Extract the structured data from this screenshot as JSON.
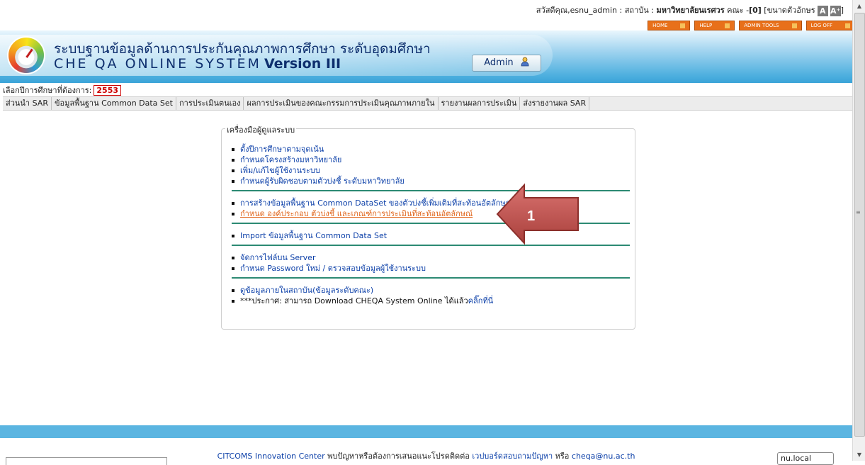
{
  "topbar": {
    "greeting": "สวัสดีคุณ,esnu_admin : สถาบัน  : ",
    "institution": "มหาวิทยาลัยนเรศวร",
    "faculty": "คณะ  -",
    "count": "[0]",
    "font_size_label": "[ขนาดตัวอักษร",
    "font_small": "A",
    "font_large": "A⁺",
    "close_bracket": "]"
  },
  "navbuttons": {
    "home": "HOME",
    "help": "HELP",
    "admin_tools": "ADMIN TOOLS",
    "logoff": "LOG OFF"
  },
  "header": {
    "title_th": "ระบบฐานข้อมูลด้านการประกันคุณภาพการศึกษา ระดับอุดมศึกษา",
    "title_en": "CHE QA ONLINE SYSTEM",
    "version": "Version III",
    "role": "Admin"
  },
  "year": {
    "label": "เลือกปีการศึกษาที่ต้องการ:",
    "value": "2553"
  },
  "menu": [
    "ส่วนนำ SAR",
    "ข้อมูลพื้นฐาน Common Data Set",
    "การประเมินตนเอง",
    "ผลการประเมินของคณะกรรมการประเมินคุณภาพภายใน",
    "รายงานผลการประเมิน",
    "ส่งรายงานผล SAR"
  ],
  "toolbox": {
    "title": "เครื่องมือผู้ดูแลระบบ",
    "group1": [
      "ตั้งปีการศึกษาตามจุดเน้น",
      "กำหนดโครงสร้างมหาวิทยาลัย",
      "เพิ่ม/แก้ไขผู้ใช้งานระบบ",
      "กำหนดผู้รับผิดชอบตามตัวบ่งชี้ ระดับมหาวิทยาลัย"
    ],
    "group2": [
      "การสร้างข้อมูลพื้นฐาน Common DataSet ของตัวบ่งชี้เพิ่มเติมที่สะท้อนอัตลักษณ์",
      "กำหนด องค์ประกอบ ตัวบ่งชี้ และเกณฑ์การประเมินที่สะท้อนอัตลักษณ์"
    ],
    "group3": [
      "Import ข้อมูลพื้นฐาน Common Data Set"
    ],
    "group4": [
      "จัดการไฟล์บน Server",
      "กำหนด Password ใหม่ / ตรวจสอบข้อมูลผู้ใช้งานระบบ"
    ],
    "group5_item": "ดูข้อมูลภายในสถาบัน(ข้อมูลระดับคณะ)",
    "announce": "***ประกาศ: สามารถ Download CHEQA System Online ได้แล้ว ",
    "announce_link": "คลิ๊กที่นี่"
  },
  "callout": {
    "number": "1"
  },
  "footer": {
    "org": "CITCOMS Innovation Center",
    "text1": " พบปัญหาหรือต้องการเสนอแนะโปรดติดต่อ ",
    "board": "เวปบอร์ดสอบถามปัญหา",
    "text2": " หรือ ",
    "email": "cheqa@nu.ac.th"
  },
  "status": {
    "domain": "nu.local"
  },
  "colors": {
    "accent_orange": "#e8701a",
    "header_blue": "#4fb0df",
    "link_blue": "#0b3fa8",
    "highlight": "#e0651b",
    "separator": "#2c8a73",
    "arrow": "#c0504d"
  }
}
